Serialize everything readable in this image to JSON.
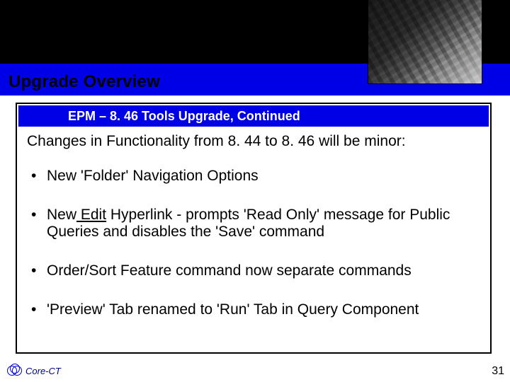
{
  "slide": {
    "title": "Upgrade Overview",
    "subtitle": "EPM – 8. 46 Tools Upgrade, Continued",
    "intro": "Changes in Functionality from 8. 44 to 8. 46 will be minor:",
    "bullets": [
      {
        "text": "New 'Folder' Navigation Options"
      },
      {
        "pre": "New",
        "link": " Edit",
        "post": " Hyperlink - prompts 'Read Only'  message for Public Queries and disables the 'Save' command"
      },
      {
        "text": "Order/Sort Feature command now separate commands"
      },
      {
        "text": "'Preview' Tab renamed to  'Run' Tab in Query Component"
      }
    ],
    "logo_text": "Core-",
    "logo_suffix": "CT",
    "page_number": "31"
  }
}
